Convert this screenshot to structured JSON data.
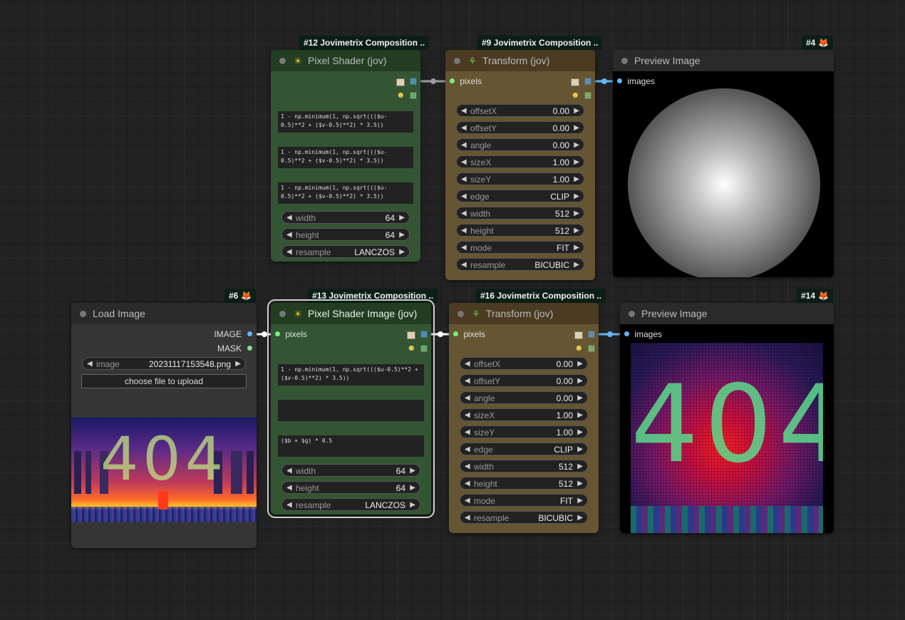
{
  "colors": {
    "wire_pixels": "#9a9a9a",
    "wire_images": "#64b5f6",
    "wire_image_input": "#ffffff",
    "green_node": "#335533",
    "brown_node": "#665533"
  },
  "badges": {
    "b12": "#12 Jovimetrix Composition ..",
    "b9": "#9 Jovimetrix Composition ..",
    "b4": "#4",
    "b6": "#6",
    "b13": "#13 Jovimetrix Composition ..",
    "b16": "#16 Jovimetrix Composition ..",
    "b14": "#14"
  },
  "icons": {
    "fox": "fox-icon",
    "sun": "sun-icon",
    "sprout": "sprout-icon"
  },
  "node12": {
    "title": "Pixel Shader (jov)",
    "exprs": [
      "1 - np.minimum(1, np.sqrt((($u-0.5)**2 + ($v-0.5)**2) * 3.5))",
      "1 - np.minimum(1, np.sqrt((($u-0.5)**2 + ($v-0.5)**2) * 3.5))",
      "1 - np.minimum(1, np.sqrt((($u-0.5)**2 + ($v-0.5)**2) * 3.5))"
    ],
    "widgets": [
      {
        "label": "width",
        "value": "64"
      },
      {
        "label": "height",
        "value": "64"
      },
      {
        "label": "resample",
        "value": "LANCZOS"
      }
    ]
  },
  "node9": {
    "title": "Transform (jov)",
    "input": "pixels",
    "widgets": [
      {
        "label": "offsetX",
        "value": "0.00"
      },
      {
        "label": "offsetY",
        "value": "0.00"
      },
      {
        "label": "angle",
        "value": "0.00"
      },
      {
        "label": "sizeX",
        "value": "1.00"
      },
      {
        "label": "sizeY",
        "value": "1.00"
      },
      {
        "label": "edge",
        "value": "CLIP"
      },
      {
        "label": "width",
        "value": "512"
      },
      {
        "label": "height",
        "value": "512"
      },
      {
        "label": "mode",
        "value": "FIT"
      },
      {
        "label": "resample",
        "value": "BICUBIC"
      }
    ]
  },
  "node4": {
    "title": "Preview Image",
    "input": "images"
  },
  "node6": {
    "title": "Load Image",
    "outputs": [
      "IMAGE",
      "MASK"
    ],
    "image_label": "image",
    "image_value": "20231117153548.png",
    "upload_label": "choose file to upload",
    "photo_text": "404"
  },
  "node13": {
    "title": "Pixel Shader Image (jov)",
    "input": "pixels",
    "exprs": [
      "1 - np.minimum(1, np.sqrt((($u-0.5)**2 + ($v-0.5)**2) * 3.5))",
      "",
      "($b + $g) * 0.5"
    ],
    "widgets": [
      {
        "label": "width",
        "value": "64"
      },
      {
        "label": "height",
        "value": "64"
      },
      {
        "label": "resample",
        "value": "LANCZOS"
      }
    ]
  },
  "node16": {
    "title": "Transform (jov)",
    "input": "pixels",
    "widgets": [
      {
        "label": "offsetX",
        "value": "0.00"
      },
      {
        "label": "offsetY",
        "value": "0.00"
      },
      {
        "label": "angle",
        "value": "0.00"
      },
      {
        "label": "sizeX",
        "value": "1.00"
      },
      {
        "label": "sizeY",
        "value": "1.00"
      },
      {
        "label": "edge",
        "value": "CLIP"
      },
      {
        "label": "width",
        "value": "512"
      },
      {
        "label": "height",
        "value": "512"
      },
      {
        "label": "mode",
        "value": "FIT"
      },
      {
        "label": "resample",
        "value": "BICUBIC"
      }
    ]
  },
  "node14": {
    "title": "Preview Image",
    "input": "images",
    "photo_text": "404"
  }
}
